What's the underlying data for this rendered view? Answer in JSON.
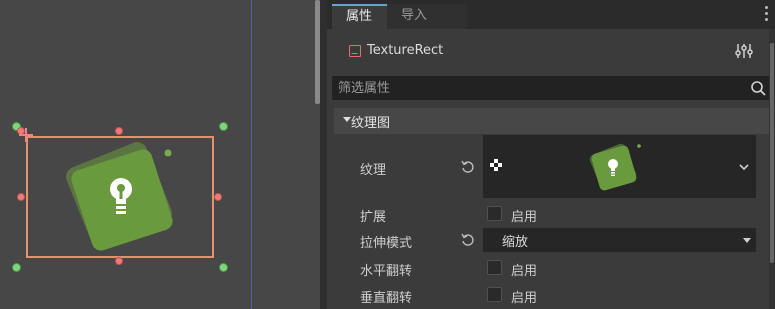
{
  "inspector": {
    "tabs": [
      {
        "label": "属性",
        "active": true
      },
      {
        "label": "导入",
        "active": false
      }
    ],
    "object_name": "TextureRect",
    "filter": {
      "placeholder": "筛选属性",
      "value": ""
    },
    "section": {
      "label": "纹理图",
      "expanded": true
    },
    "properties": {
      "texture": {
        "label": "纹理"
      },
      "expand": {
        "label": "扩展",
        "checked": false,
        "on_label": "启用"
      },
      "stretch_mode": {
        "label": "拉伸模式",
        "value": "缩放"
      },
      "flip_h": {
        "label": "水平翻转",
        "checked": false,
        "on_label": "启用"
      },
      "flip_v": {
        "label": "垂直翻转",
        "checked": false,
        "on_label": "启用"
      }
    }
  },
  "colors": {
    "selection_outline": "#e2916a",
    "handle": "#f07a7a",
    "handle_corner": "#7ed57b",
    "texture_green": "#6a9a3e",
    "tab_accent": "#6ea0d8",
    "node_icon": "#e07070"
  },
  "icons": [
    "revert-icon",
    "search-icon",
    "tune-icon",
    "checkerboard-icon",
    "chevron-down-icon",
    "lightbulb-icon"
  ]
}
